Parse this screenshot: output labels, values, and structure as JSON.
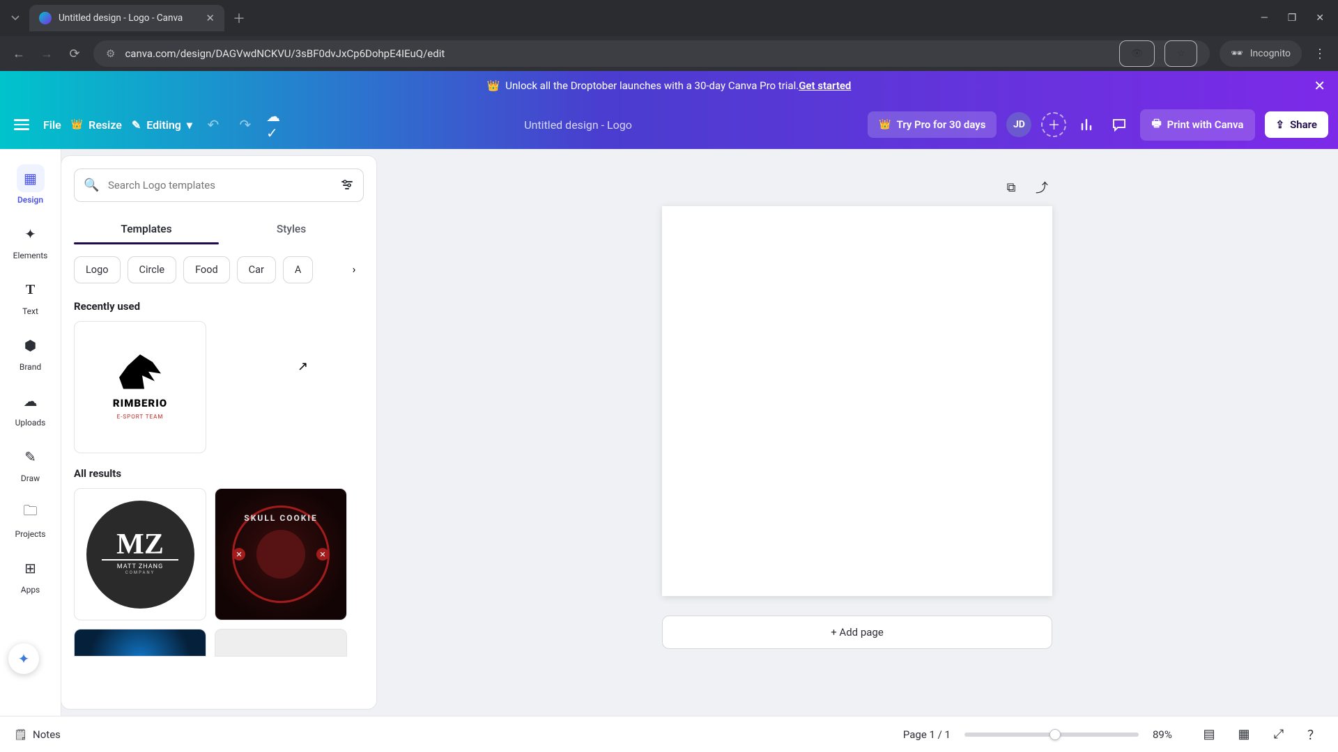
{
  "browser": {
    "tab_title": "Untitled design - Logo - Canva",
    "url_display": "canva.com/design/DAGVwdNCKVU/3sBF0dvJxCp6DohpE4IEuQ/edit",
    "incognito_label": "Incognito"
  },
  "promo": {
    "crown": "👑",
    "text": "Unlock all the Droptober launches with a 30-day Canva Pro trial. ",
    "cta": "Get started"
  },
  "toolbar": {
    "file": "File",
    "resize": "Resize",
    "editing": "Editing",
    "design_name": "Untitled design - Logo",
    "try_pro": "Try Pro for 30 days",
    "avatar_initials": "JD",
    "print": "Print with Canva",
    "share": "Share"
  },
  "rail": [
    {
      "icon": "▦",
      "label": "Design"
    },
    {
      "icon": "✦",
      "label": "Elements"
    },
    {
      "icon": "T",
      "label": "Text"
    },
    {
      "icon": "⬢",
      "label": "Brand"
    },
    {
      "icon": "☁",
      "label": "Uploads"
    },
    {
      "icon": "✎",
      "label": "Draw"
    },
    {
      "icon": "🗀",
      "label": "Projects"
    },
    {
      "icon": "⊞",
      "label": "Apps"
    }
  ],
  "panel": {
    "search_placeholder": "Search Logo templates",
    "tabs": {
      "templates": "Templates",
      "styles": "Styles"
    },
    "chips": [
      "Logo",
      "Circle",
      "Food",
      "Car",
      "A"
    ],
    "recently_used_label": "Recently used",
    "all_results_label": "All results",
    "recent": {
      "name": "RIMBERIO",
      "sub": "E-SPORT TEAM"
    },
    "results": {
      "mz_name": "MATT ZHANG",
      "mz_sub": "COMPANY",
      "skull_label": "SKULL COOKIE"
    }
  },
  "canvas": {
    "add_page": "+ Add page"
  },
  "bottom": {
    "notes": "Notes",
    "page_indicator": "Page 1 / 1",
    "zoom": "89%"
  }
}
